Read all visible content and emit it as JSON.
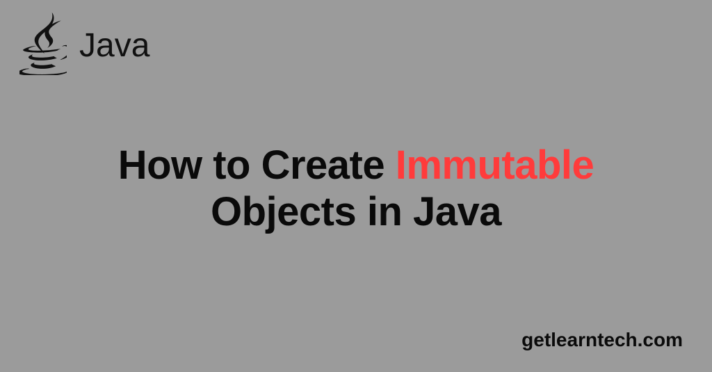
{
  "logo": {
    "text": "Java",
    "icon_name": "java-cup-icon"
  },
  "title": {
    "prefix": "How to Create ",
    "highlight": "Immutable",
    "suffix": " Objects in Java"
  },
  "footer": {
    "site": "getlearntech.com"
  },
  "colors": {
    "background": "#9b9b9b",
    "text": "#0a0a0a",
    "accent": "#ff3b3b"
  }
}
